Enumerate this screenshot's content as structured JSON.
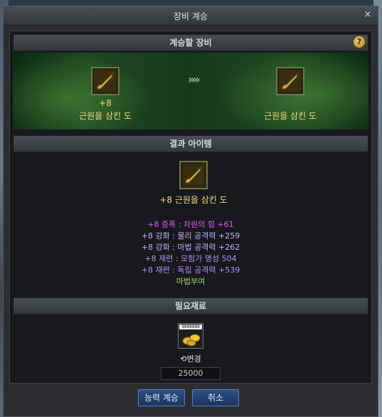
{
  "window": {
    "title": "장비 계승",
    "close": "×"
  },
  "section_source": {
    "title": "계승할 장비",
    "help": "?"
  },
  "source_item": {
    "enhance": "+8",
    "name": "근원을 삼킨 도"
  },
  "target_item": {
    "name": "근원을 삼킨 도"
  },
  "arrows": "»»",
  "section_result": {
    "title": "결과 아이템"
  },
  "result_item": {
    "name": "+8 근원을 삼킨 도"
  },
  "stats": [
    {
      "text": "+8 증폭 : 차원의 힘 +61",
      "color": "#e05ce8"
    },
    {
      "text": "+8 강화 : 물리 공격력 +259",
      "color": "#c9a8ff"
    },
    {
      "text": "+8 강화 : 마법 공격력 +262",
      "color": "#c9a8ff"
    },
    {
      "text": "+8 재련 : 모험가 명성 504",
      "color": "#b48cff"
    },
    {
      "text": "+8 재련 : 독립 공격력 +539",
      "color": "#b48cff"
    },
    {
      "text": "마법부여",
      "color": "#8ce06e"
    }
  ],
  "section_materials": {
    "title": "필요재료"
  },
  "material": {
    "count": "9999999",
    "change_label": "변경",
    "quantity": "25000"
  },
  "buttons": {
    "confirm": "능력 계승",
    "cancel": "취소"
  }
}
